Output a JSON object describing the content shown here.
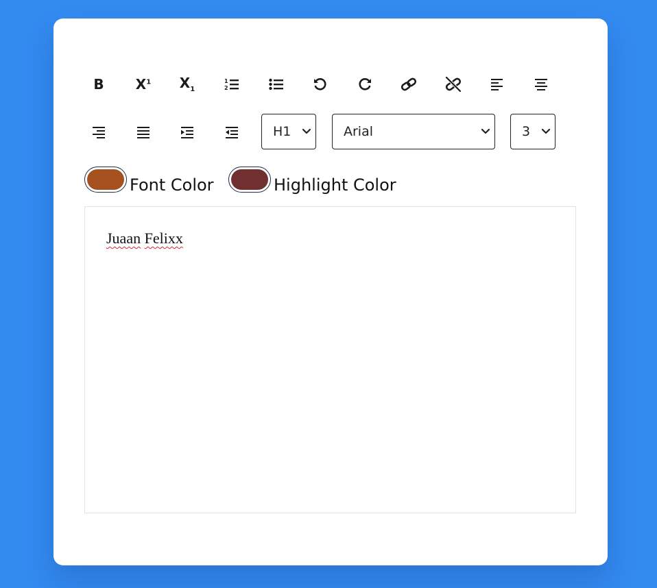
{
  "toolbar": {
    "bold_label": "B",
    "superscript_label": "X",
    "superscript_mark": "1",
    "subscript_label": "X",
    "subscript_mark": "1",
    "buttons": [
      {
        "name": "bold",
        "icon": "bold-icon"
      },
      {
        "name": "superscript",
        "icon": "superscript-icon"
      },
      {
        "name": "subscript",
        "icon": "subscript-icon"
      },
      {
        "name": "ordered-list",
        "icon": "ordered-list-icon"
      },
      {
        "name": "unordered-list",
        "icon": "unordered-list-icon"
      },
      {
        "name": "undo",
        "icon": "undo-icon"
      },
      {
        "name": "redo",
        "icon": "redo-icon"
      },
      {
        "name": "link",
        "icon": "link-icon"
      },
      {
        "name": "unlink",
        "icon": "unlink-icon"
      },
      {
        "name": "align-left",
        "icon": "align-left-icon"
      },
      {
        "name": "align-center",
        "icon": "align-center-icon"
      },
      {
        "name": "align-right",
        "icon": "align-right-icon"
      },
      {
        "name": "justify",
        "icon": "justify-icon"
      },
      {
        "name": "indent",
        "icon": "indent-icon"
      },
      {
        "name": "outdent",
        "icon": "outdent-icon"
      }
    ],
    "heading_select": {
      "value": "H1"
    },
    "font_select": {
      "value": "Arial"
    },
    "size_select": {
      "value": "3"
    }
  },
  "colors": {
    "font_color_label": "Font Color",
    "font_color_value": "#a5511f",
    "highlight_color_label": "Highlight Color",
    "highlight_color_value": "#722f2f"
  },
  "editor": {
    "word1": "Juaan",
    "word2": "Felixx"
  },
  "theme": {
    "background": "#338aef",
    "card": "#ffffff",
    "spellcheck_underline": "#d9262c"
  }
}
